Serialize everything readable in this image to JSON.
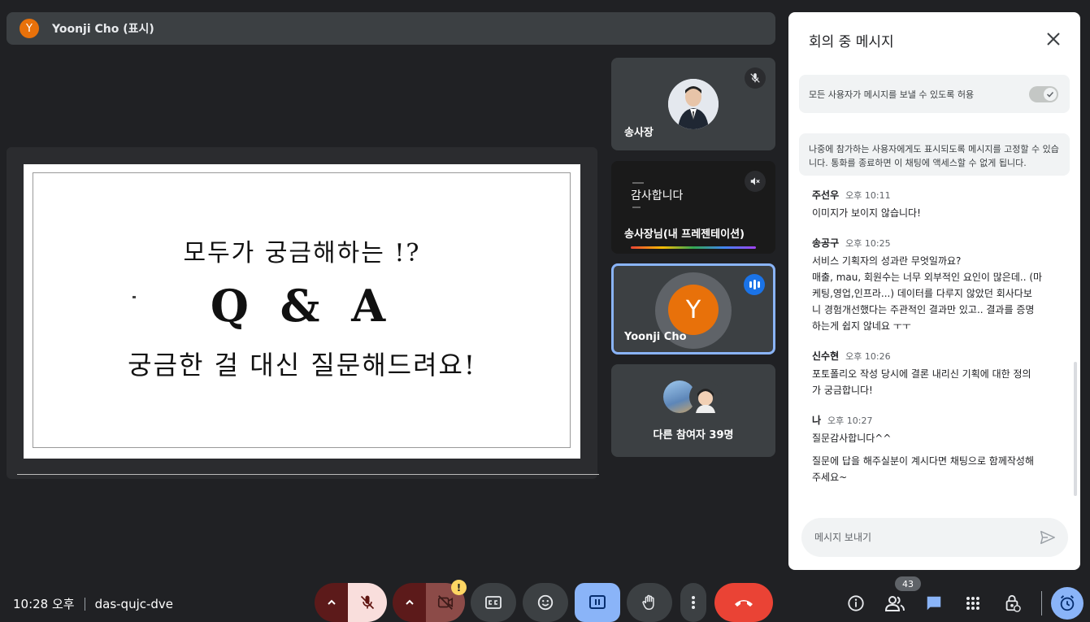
{
  "presenter_bar": {
    "avatar_letter": "Y",
    "name": "Yoonji Cho (표시)"
  },
  "slide": {
    "line1": "모두가 궁금해하는 !?",
    "line2": "Q & A",
    "line3": "궁금한 걸 대신 질문해드려요!"
  },
  "participants": {
    "tile1": {
      "name": "송사장",
      "muted": true
    },
    "tile2": {
      "preview_title": "감사합니다",
      "name": "송사장님(내 프레젠테이션)",
      "audio_off": true
    },
    "tile3": {
      "avatar_letter": "Y",
      "name": "Yoonji Cho",
      "speaking": true
    },
    "tile4": {
      "label": "다른 참여자 39명"
    }
  },
  "chat": {
    "title": "회의 중 메시지",
    "allow_all_label": "모든 사용자가 메시지를 보낼 수 있도록 허용",
    "allow_all_enabled": true,
    "pin_notice": "나중에 참가하는 사용자에게도 표시되도록 메시지를 고정할 수 있습니다. 통화를 종료하면 이 채팅에 액세스할 수 없게 됩니다.",
    "messages": [
      {
        "sender": "주선우",
        "time": "오후 10:11",
        "lines": [
          "이미지가 보이지 않습니다!"
        ]
      },
      {
        "sender": "송공구",
        "time": "오후 10:25",
        "lines": [
          "서비스 기획자의 성과란 무엇일까요?",
          "매출, mau, 회원수는 너무 외부적인 요인이 많은데.. (마",
          "케팅,영업,인프라...) 데이터를 다루지 않았던 회사다보",
          "니 경험개선했다는 주관적인 결과만 있고.. 결과를 증명",
          "하는게 쉽지 않네요 ㅜㅜ"
        ]
      },
      {
        "sender": "신수현",
        "time": "오후 10:26",
        "lines": [
          "포토폴리오 작성 당시에 결론 내리신 기획에 대한 정의",
          "가 궁금합니다!"
        ]
      },
      {
        "sender": "나",
        "time": "오후 10:27",
        "lines": [
          "질문감사합니다^^"
        ],
        "lines2": [
          "질문에 답을 해주실분이 계시다면 채팅으로 함께작성해",
          "주세요~"
        ]
      }
    ],
    "compose_placeholder": "메시지 보내기"
  },
  "bottom": {
    "time": "10:28 오후",
    "meeting_code": "das-qujc-dve",
    "participant_count": "43",
    "camera_warning": "!"
  },
  "colors": {
    "background": "#202124",
    "tile": "#3c4043",
    "avatar_orange": "#e8710a",
    "accent_blue": "#8ab4f8",
    "leave_red": "#ea4335",
    "mic_off_bg": "#f9dedc"
  },
  "icons": [
    "mic-off-icon",
    "audio-off-icon",
    "speaking-icon",
    "close-icon",
    "check-icon",
    "send-icon",
    "chevron-up-icon",
    "camera-off-icon",
    "captions-icon",
    "emoji-icon",
    "present-icon",
    "hand-icon",
    "more-vert-icon",
    "call-end-icon",
    "info-icon",
    "people-icon",
    "chat-icon",
    "apps-icon",
    "host-controls-icon",
    "timer-icon"
  ]
}
